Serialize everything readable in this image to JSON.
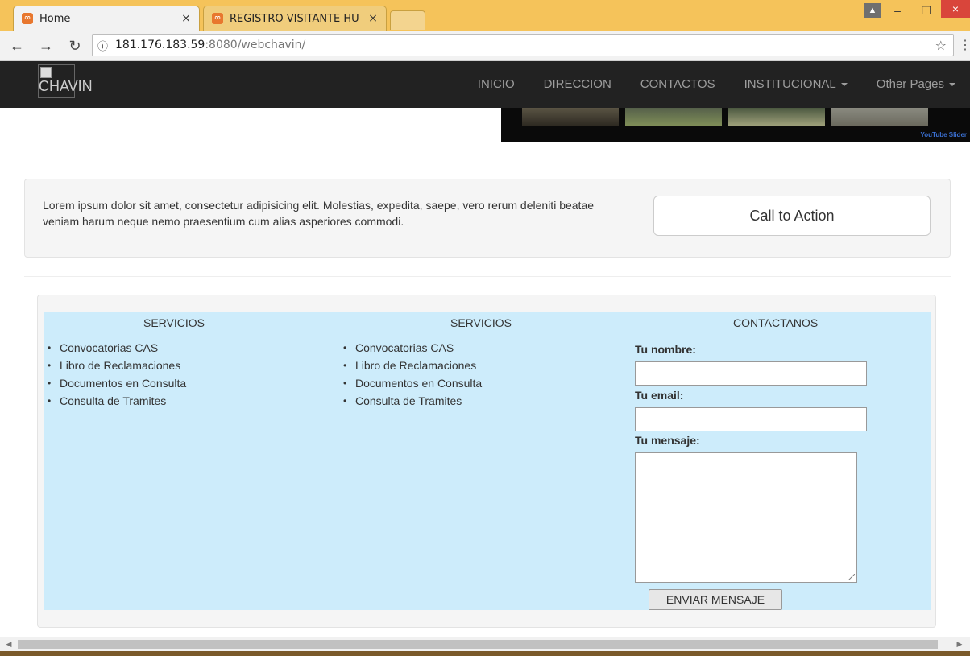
{
  "browser": {
    "tabs": [
      {
        "title": "Home",
        "icon": "xampp-favicon-icon"
      },
      {
        "title": "REGISTRO VISITANTE HU",
        "icon": "xampp-favicon-icon"
      }
    ],
    "url_host": "181.176.183.59",
    "url_rest": ":8080/webchavin/",
    "colors": {
      "titlebar": "#f5c35a",
      "close": "#d9453b"
    }
  },
  "navbar": {
    "brand": "CHAVIN",
    "links": [
      "INICIO",
      "DIRECCION",
      "CONTACTOS",
      "INSTITUCIONAL",
      "Other Pages"
    ],
    "video_label": "YouTube Slider"
  },
  "well": {
    "text": "Lorem ipsum dolor sit amet, consectetur adipisicing elit. Molestias, expedita, saepe, vero rerum deleniti beatae veniam harum neque nemo praesentium cum alias asperiores commodi.",
    "cta_label": "Call to Action"
  },
  "footer": {
    "col1": {
      "heading": "SERVICIOS",
      "items": [
        "Convocatorias CAS",
        "Libro de Reclamaciones",
        "Documentos en Consulta",
        "Consulta de Tramites"
      ]
    },
    "col2": {
      "heading": "SERVICIOS",
      "items": [
        "Convocatorias CAS",
        "Libro de Reclamaciones",
        "Documentos en Consulta",
        "Consulta de Tramites"
      ]
    },
    "contact": {
      "heading": "CONTACTANOS",
      "name_label": "Tu nombre:",
      "name_value": "",
      "email_label": "Tu email:",
      "email_value": "",
      "message_label": "Tu mensaje:",
      "message_value": "",
      "submit_label": "ENVIAR MENSAJE"
    },
    "background": "#cdecfb"
  }
}
